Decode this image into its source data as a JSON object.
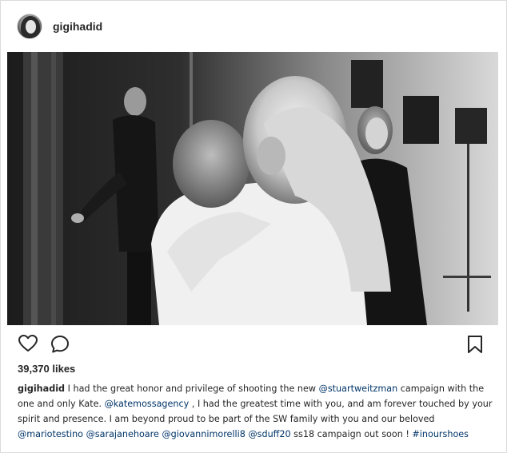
{
  "post": {
    "username": "gigihadid",
    "likes": "39,370 likes",
    "caption": {
      "author": "gigihadid",
      "segments": [
        {
          "type": "text",
          "value": " I had the great honor and privilege of shooting the new "
        },
        {
          "type": "mention",
          "value": "@stuartweitzman"
        },
        {
          "type": "text",
          "value": " campaign with the one and only Kate. "
        },
        {
          "type": "mention",
          "value": "@katemossagency"
        },
        {
          "type": "text",
          "value": " , I had the greatest time with you, and am forever touched by your spirit and presence. I am beyond proud to be part of the SW family with you and our beloved "
        },
        {
          "type": "mention",
          "value": "@mariotestino"
        },
        {
          "type": "text",
          "value": " "
        },
        {
          "type": "mention",
          "value": "@sarajanehoare"
        },
        {
          "type": "text",
          "value": " "
        },
        {
          "type": "mention",
          "value": "@giovannimorelli8"
        },
        {
          "type": "text",
          "value": " "
        },
        {
          "type": "mention",
          "value": "@sduff20"
        },
        {
          "type": "text",
          "value": " ss18 campaign out soon ! "
        },
        {
          "type": "hashtag",
          "value": "#inourshoes"
        }
      ]
    }
  },
  "icons": {
    "like": "heart-icon",
    "comment": "comment-bubble-icon",
    "save": "bookmark-icon"
  },
  "colors": {
    "link": "#003569",
    "text": "#262626",
    "border": "#dbdbdb"
  }
}
